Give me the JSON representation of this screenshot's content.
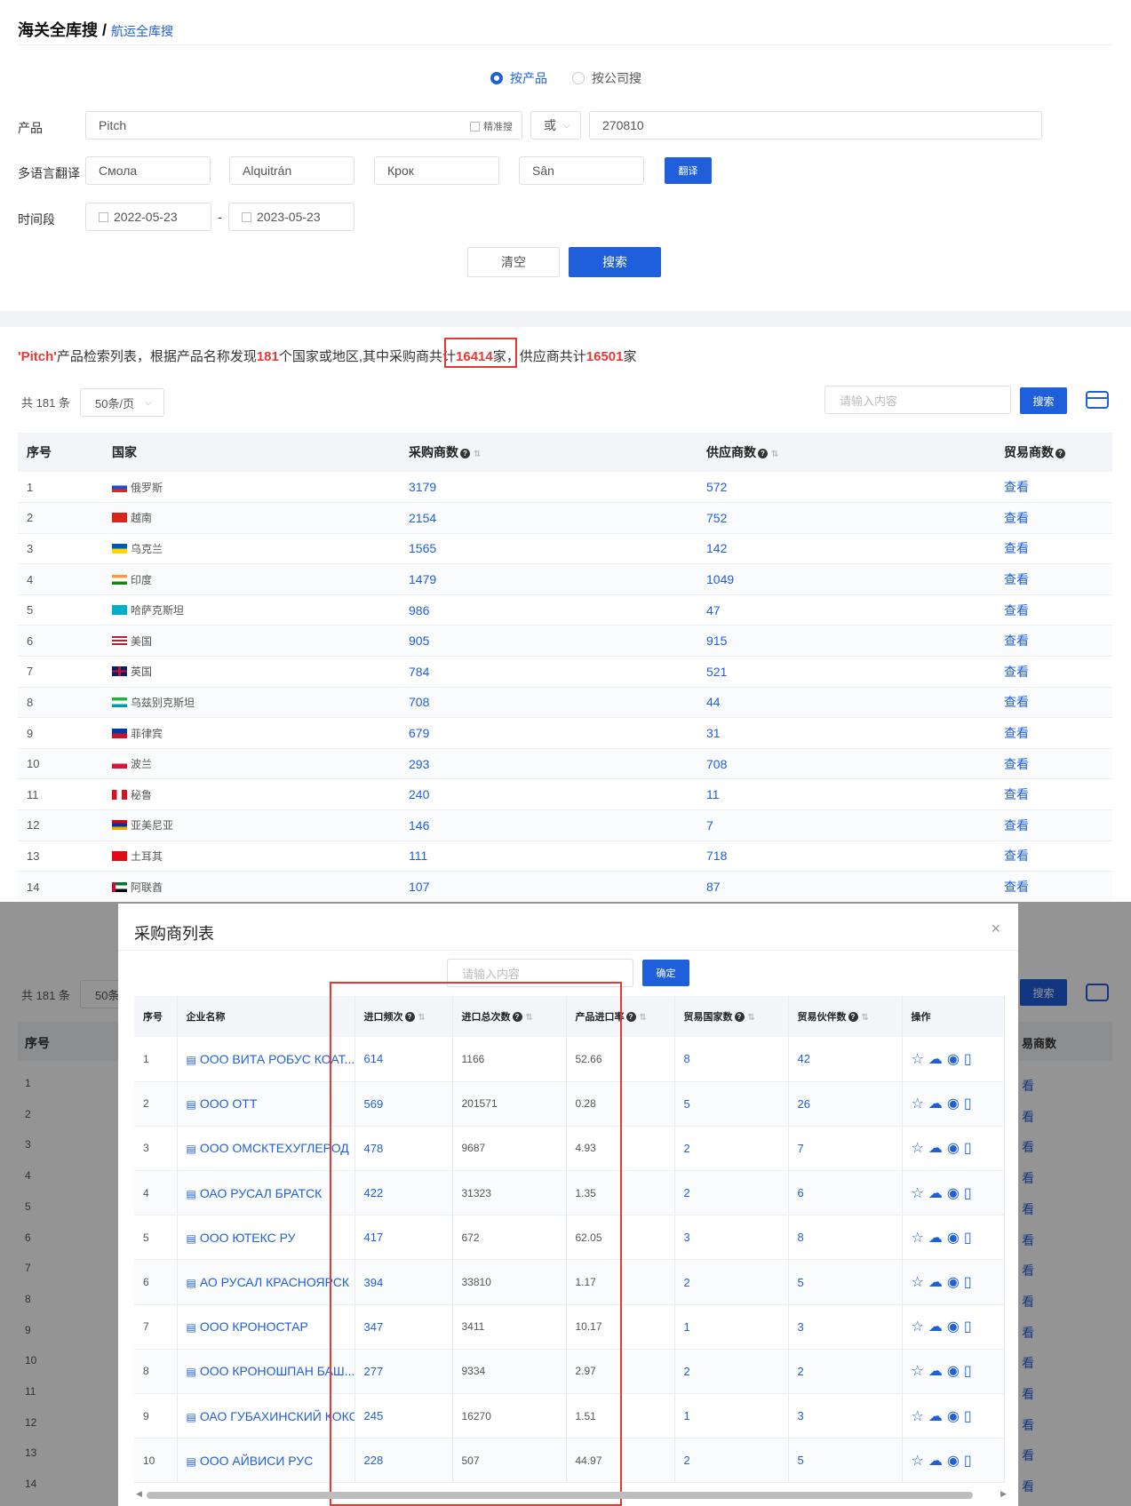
{
  "header": {
    "title": "海关全库搜",
    "sep": " / ",
    "sub": "航运全库搜"
  },
  "search": {
    "mode_product": "按产品",
    "mode_company": "按公司搜",
    "product_label": "产品",
    "product_value": "Pitch",
    "exact_label": "精准搜",
    "or_label": "或",
    "hs_value": "270810",
    "translate_label": "多语言翻译",
    "translations": [
      "Смола",
      "Alquitrán",
      "Крок",
      "Sân"
    ],
    "translate_btn": "翻译",
    "period_label": "时间段",
    "date_from": "2022-05-23",
    "date_dash": "-",
    "date_to": "2023-05-23",
    "clear_btn": "清空",
    "search_btn": "搜索"
  },
  "summary": {
    "q": "'Pitch'",
    "t1": "产品检索列表，根据产品名称发现",
    "countries": "181",
    "t2": "个国家或地区,其中采购商共计",
    "buyers": "16414",
    "t3": "家，供应商共计",
    "suppliers": "16501",
    "t4": "家"
  },
  "listbar": {
    "total": "共 181 条",
    "page_size": "50条/页",
    "filter_placeholder": "请输入内容",
    "search_btn": "搜索"
  },
  "table": {
    "headers": {
      "no": "序号",
      "country": "国家",
      "buyers": "采购商数",
      "suppliers": "供应商数",
      "traders": "贸易商数"
    },
    "view": "查看",
    "rows": [
      {
        "no": "1",
        "country": "俄罗斯",
        "buyers": "3179",
        "suppliers": "572"
      },
      {
        "no": "2",
        "country": "越南",
        "buyers": "2154",
        "suppliers": "752"
      },
      {
        "no": "3",
        "country": "乌克兰",
        "buyers": "1565",
        "suppliers": "142"
      },
      {
        "no": "4",
        "country": "印度",
        "buyers": "1479",
        "suppliers": "1049"
      },
      {
        "no": "5",
        "country": "哈萨克斯坦",
        "buyers": "986",
        "suppliers": "47"
      },
      {
        "no": "6",
        "country": "美国",
        "buyers": "905",
        "suppliers": "915"
      },
      {
        "no": "7",
        "country": "英国",
        "buyers": "784",
        "suppliers": "521"
      },
      {
        "no": "8",
        "country": "乌兹别克斯坦",
        "buyers": "708",
        "suppliers": "44"
      },
      {
        "no": "9",
        "country": "菲律宾",
        "buyers": "679",
        "suppliers": "31"
      },
      {
        "no": "10",
        "country": "波兰",
        "buyers": "293",
        "suppliers": "708"
      },
      {
        "no": "11",
        "country": "秘鲁",
        "buyers": "240",
        "suppliers": "11"
      },
      {
        "no": "12",
        "country": "亚美尼亚",
        "buyers": "146",
        "suppliers": "7"
      },
      {
        "no": "13",
        "country": "土耳其",
        "buyers": "111",
        "suppliers": "718"
      },
      {
        "no": "14",
        "country": "阿联酋",
        "buyers": "107",
        "suppliers": "87"
      }
    ]
  },
  "colors": {
    "accent": "#1f5fdc",
    "highlight": "#e53935"
  },
  "modal": {
    "title": "采购商列表",
    "filter_placeholder": "请输入内容",
    "confirm_btn": "确定",
    "headers": {
      "no": "序号",
      "company": "企业名称",
      "freq": "进口频次",
      "total": "进口总次数",
      "rate": "产品进口率",
      "countries": "贸易国家数",
      "partners": "贸易伙伴数",
      "ops": "操作"
    },
    "rows": [
      {
        "no": "1",
        "company": "ООО ВИТА РОБУС КОАТ...",
        "freq": "614",
        "total": "1166",
        "rate": "52.66",
        "countries": "8",
        "partners": "42"
      },
      {
        "no": "2",
        "company": "ООО ОТТ",
        "freq": "569",
        "total": "201571",
        "rate": "0.28",
        "countries": "5",
        "partners": "26"
      },
      {
        "no": "3",
        "company": "ООО ОМСКТЕХУГЛЕРОД",
        "freq": "478",
        "total": "9687",
        "rate": "4.93",
        "countries": "2",
        "partners": "7"
      },
      {
        "no": "4",
        "company": "ОАО РУСАЛ БРАТСК",
        "freq": "422",
        "total": "31323",
        "rate": "1.35",
        "countries": "2",
        "partners": "6"
      },
      {
        "no": "5",
        "company": "ООО ЮТЕКС РУ",
        "freq": "417",
        "total": "672",
        "rate": "62.05",
        "countries": "3",
        "partners": "8"
      },
      {
        "no": "6",
        "company": "АО РУСАЛ КРАСНОЯРСК",
        "freq": "394",
        "total": "33810",
        "rate": "1.17",
        "countries": "2",
        "partners": "5"
      },
      {
        "no": "7",
        "company": "ООО КРОНОСТАР",
        "freq": "347",
        "total": "3411",
        "rate": "10.17",
        "countries": "1",
        "partners": "3"
      },
      {
        "no": "8",
        "company": "ООО КРОНОШПАН БАШ...",
        "freq": "277",
        "total": "9334",
        "rate": "2.97",
        "countries": "2",
        "partners": "2"
      },
      {
        "no": "9",
        "company": "ОАО ГУБАХИНСКИЙ КОКС",
        "freq": "245",
        "total": "16270",
        "rate": "1.51",
        "countries": "1",
        "partners": "3"
      },
      {
        "no": "10",
        "company": "ООО АЙВИСИ РУС",
        "freq": "228",
        "total": "507",
        "rate": "44.97",
        "countries": "2",
        "partners": "5"
      }
    ]
  },
  "bg": {
    "total": "共 181 条",
    "page": "50条",
    "no_header": "序号",
    "search_btn": "搜索",
    "trader_header": "易商数",
    "view_tail": "看"
  }
}
